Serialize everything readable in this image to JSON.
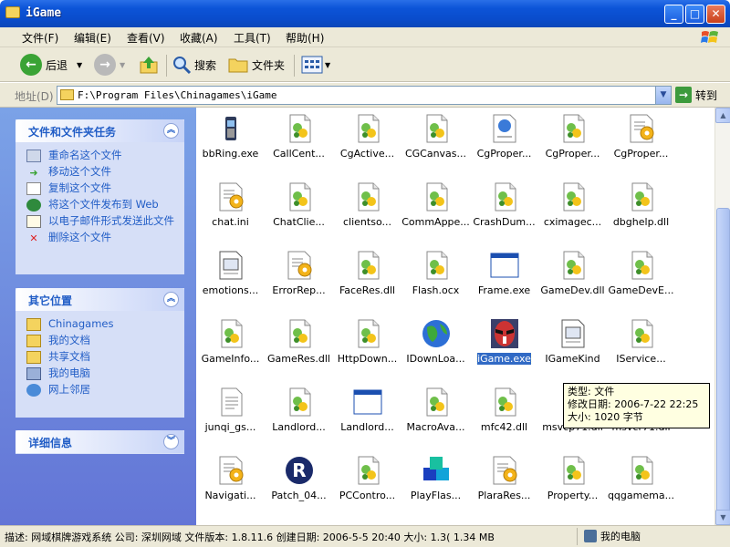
{
  "window": {
    "title": "iGame"
  },
  "menubar": {
    "items": [
      "文件(F)",
      "编辑(E)",
      "查看(V)",
      "收藏(A)",
      "工具(T)",
      "帮助(H)"
    ]
  },
  "toolbar": {
    "back": "后退",
    "search": "搜索",
    "folders": "文件夹"
  },
  "address": {
    "label": "地址(D)",
    "value": "F:\\Program Files\\Chinagames\\iGame",
    "go": "转到"
  },
  "tasks_panel": {
    "title": "文件和文件夹任务",
    "items": [
      "重命名这个文件",
      "移动这个文件",
      "复制这个文件",
      "将这个文件发布到 Web",
      "以电子邮件形式发送此文件",
      "删除这个文件"
    ]
  },
  "places_panel": {
    "title": "其它位置",
    "items": [
      "Chinagames",
      "我的文档",
      "共享文档",
      "我的电脑",
      "网上邻居"
    ]
  },
  "details_panel": {
    "title": "详细信息"
  },
  "files": [
    {
      "name": "bbRing.exe",
      "icon": "phone-exe-icon"
    },
    {
      "name": "CallCent...",
      "icon": "dll-icon"
    },
    {
      "name": "CgActive...",
      "icon": "dll-icon"
    },
    {
      "name": "CGCanvas...",
      "icon": "dll-icon"
    },
    {
      "name": "CgProper...",
      "icon": "webpage-icon"
    },
    {
      "name": "CgProper...",
      "icon": "dll-icon"
    },
    {
      "name": "CgProper...",
      "icon": "config-icon"
    },
    {
      "name": "chat.ini",
      "icon": "config-icon"
    },
    {
      "name": "ChatClie...",
      "icon": "dll-icon"
    },
    {
      "name": "clientso...",
      "icon": "dll-icon"
    },
    {
      "name": "CommAppe...",
      "icon": "dll-icon"
    },
    {
      "name": "CrashDum...",
      "icon": "dll-icon"
    },
    {
      "name": "cximagec...",
      "icon": "dll-icon"
    },
    {
      "name": "dbghelp.dll",
      "icon": "dll-icon"
    },
    {
      "name": "emotions...",
      "icon": "document-icon"
    },
    {
      "name": "ErrorRep...",
      "icon": "config-icon"
    },
    {
      "name": "FaceRes.dll",
      "icon": "dll-icon"
    },
    {
      "name": "Flash.ocx",
      "icon": "dll-icon"
    },
    {
      "name": "Frame.exe",
      "icon": "window-exe-icon"
    },
    {
      "name": "GameDev.dll",
      "icon": "dll-icon"
    },
    {
      "name": "GameDevE...",
      "icon": "dll-icon"
    },
    {
      "name": "GameInfo...",
      "icon": "dll-icon"
    },
    {
      "name": "GameRes.dll",
      "icon": "dll-icon"
    },
    {
      "name": "HttpDown...",
      "icon": "dll-icon"
    },
    {
      "name": "IDownLoa...",
      "icon": "globe-icon"
    },
    {
      "name": "iGame.exe",
      "icon": "opera-mask-icon"
    },
    {
      "name": "IGameKind",
      "icon": "document-icon"
    },
    {
      "name": "IService...",
      "icon": "dll-icon"
    },
    {
      "name": "junqi_gs...",
      "icon": "text-file-icon"
    },
    {
      "name": "Landlord...",
      "icon": "dll-icon"
    },
    {
      "name": "Landlord...",
      "icon": "window-exe-icon"
    },
    {
      "name": "MacroAva...",
      "icon": "dll-icon"
    },
    {
      "name": "mfc42.dll",
      "icon": "dll-icon"
    },
    {
      "name": "msvcp71.dll",
      "icon": "dll-icon"
    },
    {
      "name": "msvcr71.dll",
      "icon": "dll-icon"
    },
    {
      "name": "Navigati...",
      "icon": "config-icon"
    },
    {
      "name": "Patch_04...",
      "icon": "r-logo-icon"
    },
    {
      "name": "PCContro...",
      "icon": "dll-icon"
    },
    {
      "name": "PlayFlas...",
      "icon": "blocks-icon"
    },
    {
      "name": "PlaraRes...",
      "icon": "config-icon"
    },
    {
      "name": "Property...",
      "icon": "dll-icon"
    },
    {
      "name": "qqgamema...",
      "icon": "dll-icon"
    }
  ],
  "selected_index": 25,
  "tooltip": {
    "type": "类型: 文件",
    "modified": "修改日期: 2006-7-22 22:25",
    "size": "大小: 1020 字节"
  },
  "status": {
    "text": "描述: 网域棋牌游戏系统 公司: 深圳网域 文件版本: 1.8.11.6 创建日期: 2006-5-5 20:40 大小: 1.3( 1.34 MB",
    "zone": "我的电脑"
  },
  "colors": {
    "selection": "#316ac5",
    "link": "#215dc6",
    "title_bar": "#0a4ccc"
  }
}
